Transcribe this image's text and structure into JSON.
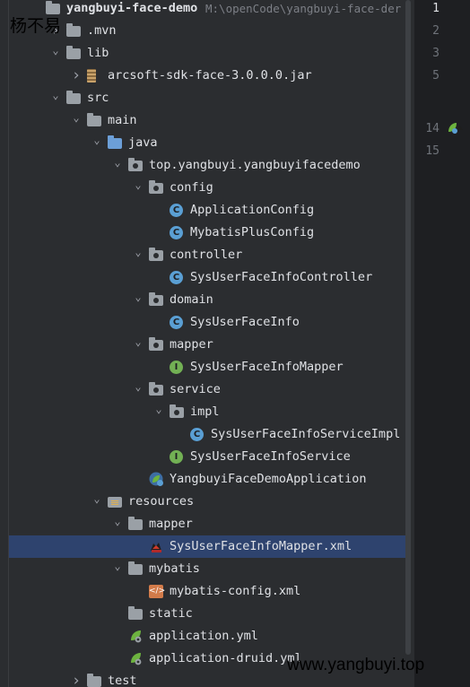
{
  "project": {
    "name": "yangbuyi-face-demo",
    "path": "M:\\openCode\\yangbuyi-face-der"
  },
  "tree": [
    {
      "indent": 0,
      "arrow": "",
      "icon": "folder",
      "label": "yangbuyi-face-demo"
    },
    {
      "indent": 1,
      "arrow": "right",
      "icon": "folder",
      "label": ".mvn"
    },
    {
      "indent": 1,
      "arrow": "down",
      "icon": "folder",
      "label": "lib"
    },
    {
      "indent": 2,
      "arrow": "right",
      "icon": "jar",
      "label": "arcsoft-sdk-face-3.0.0.0.jar"
    },
    {
      "indent": 1,
      "arrow": "down",
      "icon": "folder",
      "label": "src"
    },
    {
      "indent": 2,
      "arrow": "down",
      "icon": "folder",
      "label": "main"
    },
    {
      "indent": 3,
      "arrow": "down",
      "icon": "folder-blue",
      "label": "java"
    },
    {
      "indent": 4,
      "arrow": "down",
      "icon": "package",
      "label": "top.yangbuyi.yangbuyifacedemo"
    },
    {
      "indent": 5,
      "arrow": "down",
      "icon": "package",
      "label": "config"
    },
    {
      "indent": 6,
      "arrow": "",
      "icon": "class",
      "label": "ApplicationConfig"
    },
    {
      "indent": 6,
      "arrow": "",
      "icon": "class",
      "label": "MybatisPlusConfig"
    },
    {
      "indent": 5,
      "arrow": "down",
      "icon": "package",
      "label": "controller"
    },
    {
      "indent": 6,
      "arrow": "",
      "icon": "class",
      "label": "SysUserFaceInfoController"
    },
    {
      "indent": 5,
      "arrow": "down",
      "icon": "package",
      "label": "domain"
    },
    {
      "indent": 6,
      "arrow": "",
      "icon": "class",
      "label": "SysUserFaceInfo"
    },
    {
      "indent": 5,
      "arrow": "down",
      "icon": "package",
      "label": "mapper"
    },
    {
      "indent": 6,
      "arrow": "",
      "icon": "interface",
      "label": "SysUserFaceInfoMapper"
    },
    {
      "indent": 5,
      "arrow": "down",
      "icon": "package",
      "label": "service"
    },
    {
      "indent": 6,
      "arrow": "down",
      "icon": "package",
      "label": "impl"
    },
    {
      "indent": 7,
      "arrow": "",
      "icon": "class",
      "label": "SysUserFaceInfoServiceImpl"
    },
    {
      "indent": 6,
      "arrow": "",
      "icon": "interface",
      "label": "SysUserFaceInfoService"
    },
    {
      "indent": 5,
      "arrow": "",
      "icon": "spring-app",
      "label": "YangbuyiFaceDemoApplication"
    },
    {
      "indent": 3,
      "arrow": "down",
      "icon": "resources",
      "label": "resources"
    },
    {
      "indent": 4,
      "arrow": "down",
      "icon": "folder",
      "label": "mapper"
    },
    {
      "indent": 5,
      "arrow": "",
      "icon": "mybatis-xml",
      "label": "SysUserFaceInfoMapper.xml",
      "selected": true
    },
    {
      "indent": 4,
      "arrow": "down",
      "icon": "folder",
      "label": "mybatis"
    },
    {
      "indent": 5,
      "arrow": "",
      "icon": "xml-config",
      "label": "mybatis-config.xml"
    },
    {
      "indent": 4,
      "arrow": "",
      "icon": "folder",
      "label": "static"
    },
    {
      "indent": 4,
      "arrow": "",
      "icon": "spring-yml",
      "label": "application.yml"
    },
    {
      "indent": 4,
      "arrow": "",
      "icon": "spring-yml",
      "label": "application-druid.yml"
    },
    {
      "indent": 2,
      "arrow": "right",
      "icon": "folder",
      "label": "test"
    }
  ],
  "gutter": {
    "lines": [
      "1",
      "2",
      "3",
      "5",
      "14",
      "15"
    ]
  },
  "watermarks": {
    "author": "杨不易",
    "site": "www.yangbuyi.top"
  },
  "colors": {
    "selection": "#2e436e",
    "class_icon": "#5a9fd4",
    "interface_icon": "#72b054",
    "background": "#2b2d30"
  }
}
